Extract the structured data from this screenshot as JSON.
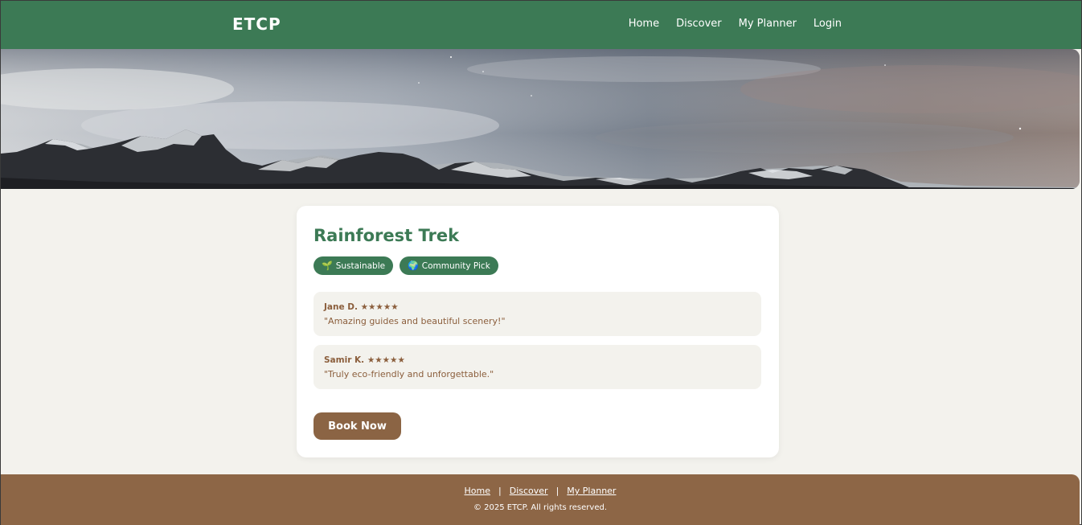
{
  "header": {
    "brand": "ETCP",
    "nav": [
      "Home",
      "Discover",
      "My Planner",
      "Login"
    ]
  },
  "trip": {
    "title": "Rainforest Trek",
    "badges": [
      {
        "icon": "seedling-icon",
        "glyph": "🌱",
        "label": "Sustainable"
      },
      {
        "icon": "globe-icon",
        "glyph": "🌍",
        "label": "Community Pick"
      }
    ],
    "reviews": [
      {
        "author": "Jane D.",
        "stars": "★★★★★",
        "rating": 5,
        "text": "\"Amazing guides and beautiful scenery!\""
      },
      {
        "author": "Samir K.",
        "stars": "★★★★★",
        "rating": 5,
        "text": "\"Truly eco-friendly and unforgettable.\""
      }
    ],
    "book_label": "Book Now"
  },
  "footer": {
    "links": [
      "Home",
      "Discover",
      "My Planner"
    ],
    "separator": "|",
    "copyright": "© 2025 ETCP. All rights reserved."
  },
  "colors": {
    "primary_green": "#3c7a55",
    "brown": "#8b6444",
    "background": "#f3f2ed"
  }
}
